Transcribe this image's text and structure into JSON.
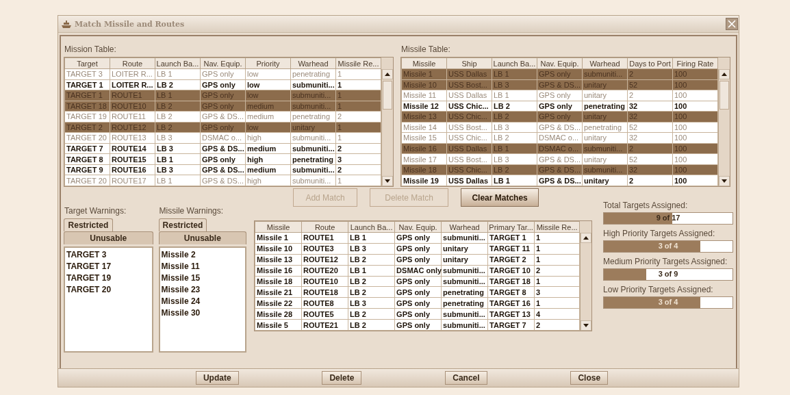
{
  "window": {
    "title": "Match Missile and Routes"
  },
  "mission_table": {
    "label": "Mission Table:",
    "columns": [
      "Target",
      "Route",
      "Launch Ba...",
      "Nav. Equip.",
      "Priority",
      "Warhead",
      "Missile Re..."
    ],
    "rows": [
      {
        "cells": [
          "TARGET 3",
          "LOITER R...",
          "LB 1",
          "GPS only",
          "low",
          "penetrating",
          "1"
        ],
        "selected": false,
        "bold": false
      },
      {
        "cells": [
          "TARGET 1",
          "LOITER R...",
          "LB 2",
          "GPS only",
          "low",
          "submuniti...",
          "1"
        ],
        "selected": false,
        "bold": true
      },
      {
        "cells": [
          "TARGET 1",
          "ROUTE1",
          "LB 1",
          "GPS only",
          "low",
          "submuniti...",
          "1"
        ],
        "selected": true,
        "bold": false
      },
      {
        "cells": [
          "TARGET 18",
          "ROUTE10",
          "LB 2",
          "GPS only",
          "medium",
          "submuniti...",
          "1"
        ],
        "selected": true,
        "bold": false
      },
      {
        "cells": [
          "TARGET 19",
          "ROUTE11",
          "LB 2",
          "GPS & DS...",
          "medium",
          "penetrating",
          "2"
        ],
        "selected": false,
        "bold": false
      },
      {
        "cells": [
          "TARGET 2",
          "ROUTE12",
          "LB 2",
          "GPS only",
          "low",
          "unitary",
          "1"
        ],
        "selected": true,
        "bold": false
      },
      {
        "cells": [
          "TARGET 20",
          "ROUTE13",
          "LB 3",
          "DSMAC o...",
          "high",
          "submuniti...",
          "1"
        ],
        "selected": false,
        "bold": false
      },
      {
        "cells": [
          "TARGET 7",
          "ROUTE14",
          "LB 3",
          "GPS & DS...",
          "medium",
          "submuniti...",
          "2"
        ],
        "selected": false,
        "bold": true
      },
      {
        "cells": [
          "TARGET 8",
          "ROUTE15",
          "LB 1",
          "GPS only",
          "high",
          "penetrating",
          "3"
        ],
        "selected": false,
        "bold": true
      },
      {
        "cells": [
          "TARGET 9",
          "ROUTE16",
          "LB 3",
          "GPS & DS...",
          "medium",
          "submuniti...",
          "2"
        ],
        "selected": false,
        "bold": true
      },
      {
        "cells": [
          "TARGET 20",
          "ROUTE17",
          "LB 1",
          "GPS & DS...",
          "high",
          "submuniti...",
          "1"
        ],
        "selected": false,
        "bold": false
      }
    ]
  },
  "missile_table": {
    "label": "Missile Table:",
    "columns": [
      "Missile",
      "Ship",
      "Launch Ba...",
      "Nav. Equip.",
      "Warhead",
      "Days to Port",
      "Firing Rate"
    ],
    "rows": [
      {
        "cells": [
          "Missile 1",
          "USS Dallas",
          "LB 1",
          "GPS only",
          "submuniti...",
          "2",
          "100"
        ],
        "selected": true,
        "bold": false
      },
      {
        "cells": [
          "Missile 10",
          "USS Bost...",
          "LB 3",
          "GPS & DS...",
          "unitary",
          "52",
          "100"
        ],
        "selected": true,
        "bold": false
      },
      {
        "cells": [
          "Missile 11",
          "USS Dallas",
          "LB 1",
          "GPS only",
          "unitary",
          "2",
          "100"
        ],
        "selected": false,
        "bold": false
      },
      {
        "cells": [
          "Missile 12",
          "USS Chic...",
          "LB 2",
          "GPS only",
          "penetrating",
          "32",
          "100"
        ],
        "selected": false,
        "bold": true
      },
      {
        "cells": [
          "Missile 13",
          "USS Chic...",
          "LB 2",
          "GPS only",
          "unitary",
          "32",
          "100"
        ],
        "selected": true,
        "bold": false
      },
      {
        "cells": [
          "Missile 14",
          "USS Bost...",
          "LB 3",
          "GPS & DS...",
          "penetrating",
          "52",
          "100"
        ],
        "selected": false,
        "bold": false
      },
      {
        "cells": [
          "Missile 15",
          "USS Chic...",
          "LB 2",
          "DSMAC o...",
          "unitary",
          "32",
          "100"
        ],
        "selected": false,
        "bold": false
      },
      {
        "cells": [
          "Missile 16",
          "USS Dallas",
          "LB 1",
          "DSMAC o...",
          "submuniti...",
          "2",
          "100"
        ],
        "selected": true,
        "bold": false
      },
      {
        "cells": [
          "Missile 17",
          "USS Bost...",
          "LB 3",
          "GPS & DS...",
          "unitary",
          "52",
          "100"
        ],
        "selected": false,
        "bold": false
      },
      {
        "cells": [
          "Missile 18",
          "USS Chic...",
          "LB 2",
          "GPS & DS...",
          "submuniti...",
          "32",
          "100"
        ],
        "selected": true,
        "bold": false
      },
      {
        "cells": [
          "Missile 19",
          "USS Dallas",
          "LB 1",
          "GPS & DS...",
          "unitary",
          "2",
          "100"
        ],
        "selected": false,
        "bold": true
      }
    ]
  },
  "target_warnings": {
    "label": "Target Warnings:",
    "tabs": [
      {
        "label": "Restricted",
        "selected": false
      },
      {
        "label": "Unusable",
        "selected": true
      }
    ],
    "items": [
      "TARGET 3",
      "TARGET 17",
      "TARGET 19",
      "TARGET 20"
    ]
  },
  "missile_warnings": {
    "label": "Missile Warnings:",
    "tabs": [
      {
        "label": "Restricted",
        "selected": false
      },
      {
        "label": "Unusable",
        "selected": true
      }
    ],
    "items": [
      "Missile 2",
      "Missile 11",
      "Missile 15",
      "Missile 23",
      "Missile 24",
      "Missile 30"
    ]
  },
  "match_buttons": [
    {
      "label": "Add Match",
      "disabled": true
    },
    {
      "label": "Delete Match",
      "disabled": true
    },
    {
      "label": "Clear Matches",
      "disabled": false
    }
  ],
  "match_table": {
    "columns": [
      "Missile",
      "Route",
      "Launch Ba...",
      "Nav. Equip.",
      "Warhead",
      "Primary Tar...",
      "Missile Re..."
    ],
    "rows": [
      {
        "cells": [
          "Missile 1",
          "ROUTE1",
          "LB 1",
          "GPS only",
          "submuniti...",
          "TARGET 1",
          "1"
        ],
        "selected": false,
        "bold": true
      },
      {
        "cells": [
          "Missile 10",
          "ROUTE3",
          "LB 3",
          "GPS only",
          "unitary",
          "TARGET 11",
          "1"
        ],
        "selected": false,
        "bold": true
      },
      {
        "cells": [
          "Missile 13",
          "ROUTE12",
          "LB 2",
          "GPS only",
          "unitary",
          "TARGET 2",
          "1"
        ],
        "selected": false,
        "bold": true
      },
      {
        "cells": [
          "Missile 16",
          "ROUTE20",
          "LB 1",
          "DSMAC only",
          "submuniti...",
          "TARGET 10",
          "2"
        ],
        "selected": false,
        "bold": true
      },
      {
        "cells": [
          "Missile 18",
          "ROUTE10",
          "LB 2",
          "GPS only",
          "submuniti...",
          "TARGET 18",
          "1"
        ],
        "selected": false,
        "bold": true
      },
      {
        "cells": [
          "Missile 21",
          "ROUTE18",
          "LB 2",
          "GPS only",
          "penetrating",
          "TARGET 8",
          "3"
        ],
        "selected": false,
        "bold": true
      },
      {
        "cells": [
          "Missile 22",
          "ROUTE8",
          "LB 3",
          "GPS only",
          "penetrating",
          "TARGET 16",
          "1"
        ],
        "selected": false,
        "bold": true
      },
      {
        "cells": [
          "Missile 28",
          "ROUTE5",
          "LB 2",
          "GPS only",
          "submuniti...",
          "TARGET 13",
          "4"
        ],
        "selected": false,
        "bold": true
      },
      {
        "cells": [
          "Missile 5",
          "ROUTE21",
          "LB 2",
          "GPS only",
          "submuniti...",
          "TARGET 7",
          "2"
        ],
        "selected": false,
        "bold": true
      }
    ]
  },
  "progress": [
    {
      "label": "Total Targets Assigned:",
      "reading": "9 of 17",
      "level": 0.53
    },
    {
      "label": "High Priority Targets Assigned:",
      "reading": "3 of 4",
      "level": 0.75
    },
    {
      "label": "Medium Priority Targets Assigned:",
      "reading": "3 of 9",
      "level": 0.33
    },
    {
      "label": "Low Priority Targets Assigned:",
      "reading": "3 of 4",
      "level": 0.75
    }
  ],
  "footer_buttons": [
    "Update",
    "Delete",
    "Cancel",
    "Close"
  ]
}
